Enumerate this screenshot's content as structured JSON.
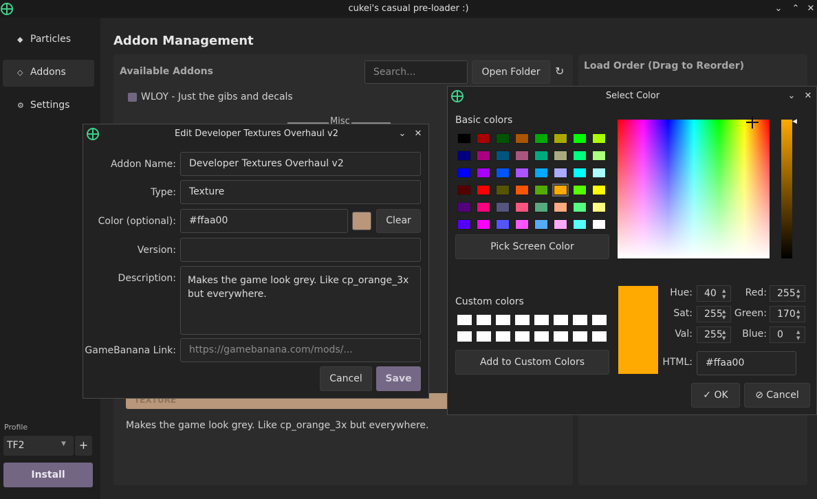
{
  "window": {
    "title": "cukei's casual pre-loader :)"
  },
  "sidebar": {
    "items": [
      {
        "label": "Particles",
        "icon": "diamond-filled-icon"
      },
      {
        "label": "Addons",
        "icon": "diamond-outline-icon"
      },
      {
        "label": "Settings",
        "icon": "gear-icon"
      }
    ],
    "profile_label": "Profile",
    "profile_value": "TF2",
    "add_profile": "+",
    "install_label": "Install"
  },
  "main": {
    "title": "Addon Management",
    "available_title": "Available Addons",
    "search_placeholder": "Search...",
    "open_folder": "Open Folder",
    "load_order_title": "Load Order (Drag to Reorder)",
    "addon_item": "WLOY - Just the gibs and decals",
    "group_label": "Misc",
    "badge_text": "TEXTURE",
    "preview_description": "Makes the game look grey. Like cp_orange_3x but everywhere."
  },
  "edit_dialog": {
    "title": "Edit Developer Textures Overhaul v2",
    "name_label": "Addon Name:",
    "name_value": "Developer Textures Overhaul v2",
    "type_label": "Type:",
    "type_value": "Texture",
    "color_label": "Color (optional):",
    "color_value": "#ffaa00",
    "color_preview": "#b8977a",
    "clear_label": "Clear",
    "version_label": "Version:",
    "version_value": "",
    "description_label": "Description:",
    "description_value": "Makes the game look grey. Like cp_orange_3x but everywhere.",
    "link_label": "GameBanana Link:",
    "link_placeholder": "https://gamebanana.com/mods/...",
    "cancel_label": "Cancel",
    "save_label": "Save"
  },
  "color_dialog": {
    "title": "Select Color",
    "basic_colors_label": "Basic colors",
    "basic_colors": [
      "#000000",
      "#aa0000",
      "#005500",
      "#aa5500",
      "#00aa00",
      "#aaaa00",
      "#00ff00",
      "#aaff00",
      "#00007f",
      "#aa007f",
      "#00557f",
      "#aa557f",
      "#00aa7f",
      "#aaaa7f",
      "#00ff7f",
      "#aaff7f",
      "#0000ff",
      "#aa00ff",
      "#0055ff",
      "#aa55ff",
      "#00aaff",
      "#aaaaff",
      "#00ffff",
      "#aaffff",
      "#550000",
      "#ff0000",
      "#555500",
      "#ff5500",
      "#55aa00",
      "#ffaa00",
      "#55ff00",
      "#ffff00",
      "#55007f",
      "#ff007f",
      "#55557f",
      "#ff557f",
      "#55aa7f",
      "#ffaa7f",
      "#55ff7f",
      "#ffff7f",
      "#5500ff",
      "#ff00ff",
      "#5555ff",
      "#ff55ff",
      "#55aaff",
      "#ffaaff",
      "#55ffff",
      "#ffffff"
    ],
    "pick_screen": "Pick Screen Color",
    "custom_colors_label": "Custom colors",
    "add_custom": "Add to Custom Colors",
    "current_color": "#ffaa00",
    "hue_label": "Hue:",
    "hue_value": "40",
    "sat_label": "Sat:",
    "sat_value": "255",
    "val_label": "Val:",
    "val_value": "255",
    "red_label": "Red:",
    "red_value": "255",
    "green_label": "Green:",
    "green_value": "170",
    "blue_label": "Blue:",
    "blue_value": "0",
    "html_label": "HTML:",
    "html_value": "#ffaa00",
    "ok_label": "OK",
    "cancel_label": "Cancel"
  }
}
